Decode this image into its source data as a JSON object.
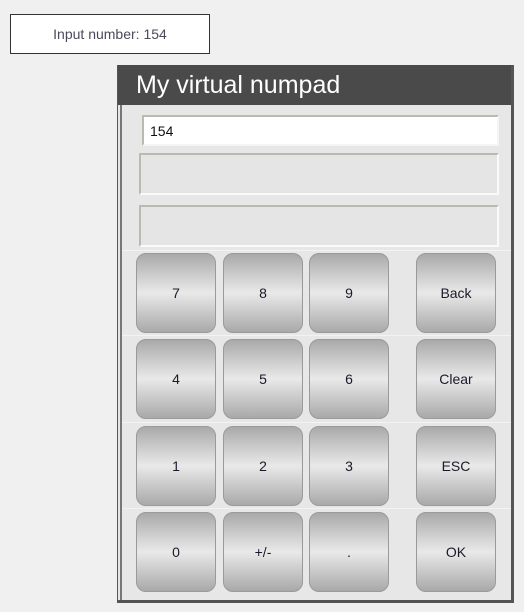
{
  "status_label": "Input number: 154",
  "dialog": {
    "title": "My virtual numpad",
    "input_value": "154",
    "display_fields": [
      "",
      ""
    ]
  },
  "keypad": {
    "rows": [
      [
        {
          "label": "7",
          "name": "key-7"
        },
        {
          "label": "8",
          "name": "key-8"
        },
        {
          "label": "9",
          "name": "key-9"
        },
        {
          "label": "Back",
          "name": "back-button"
        }
      ],
      [
        {
          "label": "4",
          "name": "key-4"
        },
        {
          "label": "5",
          "name": "key-5"
        },
        {
          "label": "6",
          "name": "key-6"
        },
        {
          "label": "Clear",
          "name": "clear-button"
        }
      ],
      [
        {
          "label": "1",
          "name": "key-1"
        },
        {
          "label": "2",
          "name": "key-2"
        },
        {
          "label": "3",
          "name": "key-3"
        },
        {
          "label": "ESC",
          "name": "esc-button"
        }
      ],
      [
        {
          "label": "0",
          "name": "key-0"
        },
        {
          "label": "+/-",
          "name": "sign-toggle-button"
        },
        {
          "label": ".",
          "name": "decimal-point-button"
        },
        {
          "label": "OK",
          "name": "ok-button"
        }
      ]
    ]
  }
}
